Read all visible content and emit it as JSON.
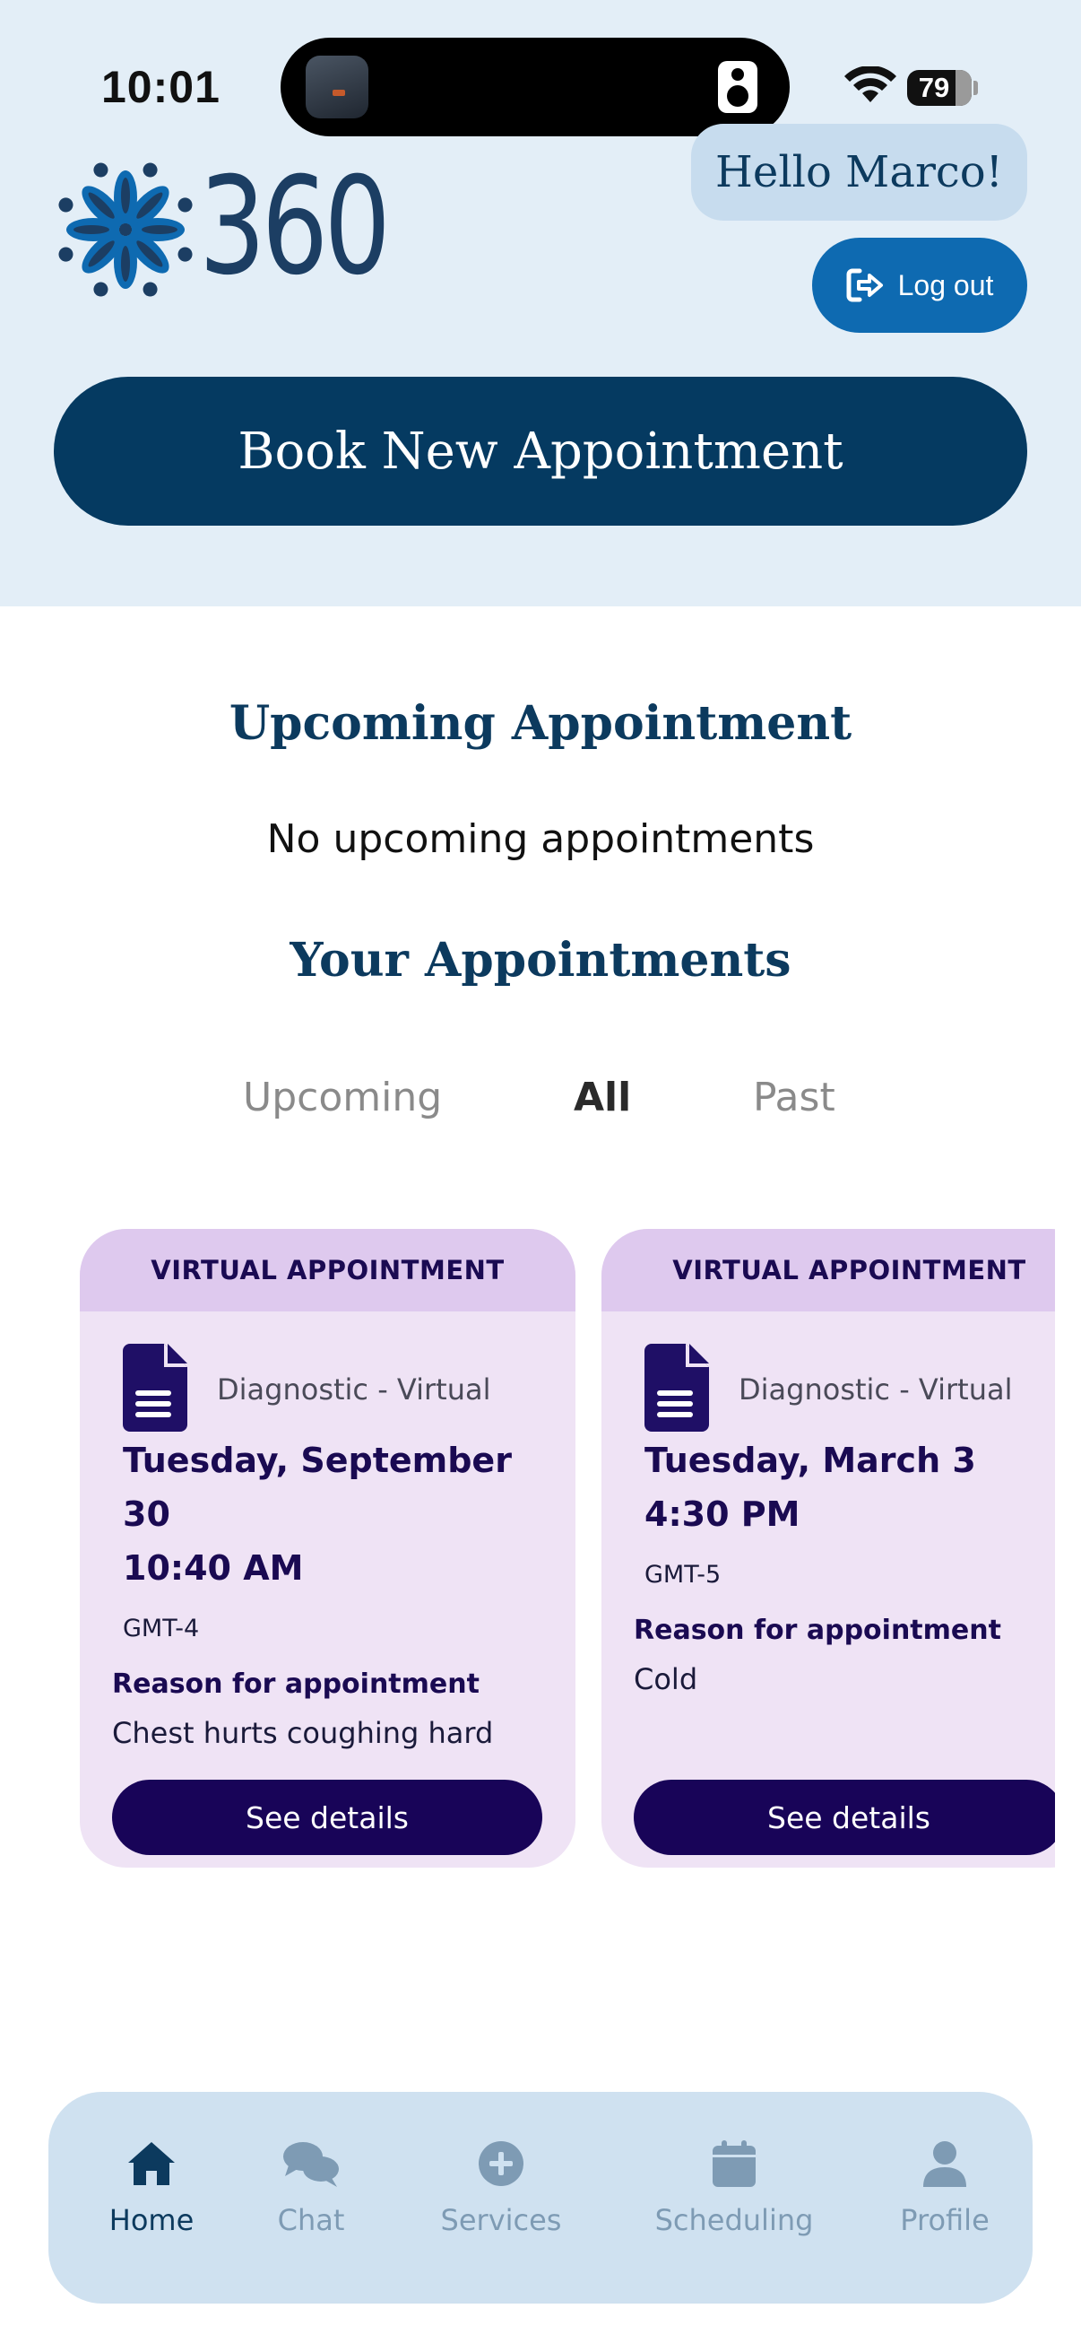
{
  "status_bar": {
    "time": "10:01",
    "battery": "79",
    "icons": [
      "wifi-icon",
      "battery-icon",
      "speaker-icon"
    ]
  },
  "header": {
    "logo_text": "360",
    "greeting": "Hello Marco!",
    "logout_label": "Log out",
    "book_label": "Book New Appointment"
  },
  "upcoming": {
    "title": "Upcoming Appointment",
    "empty_text": "No upcoming appointments"
  },
  "appointments": {
    "title": "Your Appointments",
    "tabs": [
      {
        "label": "Upcoming",
        "active": false
      },
      {
        "label": "All",
        "active": true
      },
      {
        "label": "Past",
        "active": false
      }
    ],
    "cards": [
      {
        "header": "VIRTUAL APPOINTMENT",
        "type": "Diagnostic - Virtual",
        "date": "Tuesday, September 30",
        "time": "10:40 AM",
        "timezone": "GMT-4",
        "reason_label": "Reason for appointment",
        "reason": "Chest hurts coughing hard",
        "button": "See details"
      },
      {
        "header": "VIRTUAL APPOINTMENT",
        "type": "Diagnostic - Virtual",
        "date": "Tuesday, March 3",
        "time": "4:30 PM",
        "timezone": "GMT-5",
        "reason_label": "Reason for appointment",
        "reason": "Cold",
        "button": "See details"
      }
    ]
  },
  "bottom_nav": {
    "items": [
      {
        "label": "Home",
        "icon": "home-icon",
        "active": true
      },
      {
        "label": "Chat",
        "icon": "chat-icon",
        "active": false
      },
      {
        "label": "Services",
        "icon": "plus-circle-icon",
        "active": false
      },
      {
        "label": "Scheduling",
        "icon": "calendar-icon",
        "active": false
      },
      {
        "label": "Profile",
        "icon": "user-icon",
        "active": false
      }
    ]
  },
  "colors": {
    "header_bg": "#e3eef7",
    "primary_dark": "#053a61",
    "logout_blue": "#0e6ab1",
    "card_bg": "#efe3f5",
    "card_header_bg": "#dec9ee",
    "button_dark": "#180458",
    "nav_bg": "#cfe1f0"
  }
}
